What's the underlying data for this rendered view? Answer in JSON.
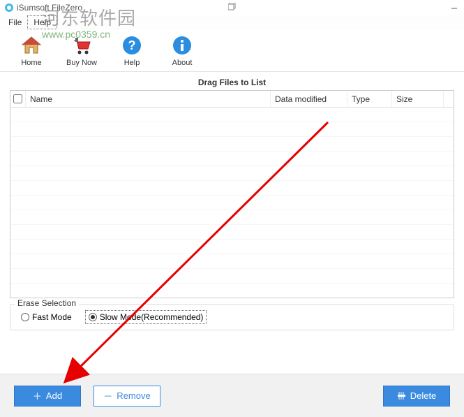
{
  "window": {
    "title": "iSumsoft FileZero"
  },
  "menu": {
    "file": "File",
    "help": "Help"
  },
  "watermark": {
    "cn": "河东软件园",
    "url": "www.pc0359.cn"
  },
  "toolbar": {
    "home": "Home",
    "buy": "Buy Now",
    "help": "Help",
    "about": "About"
  },
  "main": {
    "drag_label": "Drag Files to List"
  },
  "columns": {
    "name": "Name",
    "date": "Data modified",
    "type": "Type",
    "size": "Size"
  },
  "erase": {
    "legend": "Erase Selection",
    "fast": "Fast Mode",
    "slow": "Slow Mode(Recommended)"
  },
  "buttons": {
    "add": "Add",
    "remove": "Remove",
    "delete": "Delete"
  }
}
